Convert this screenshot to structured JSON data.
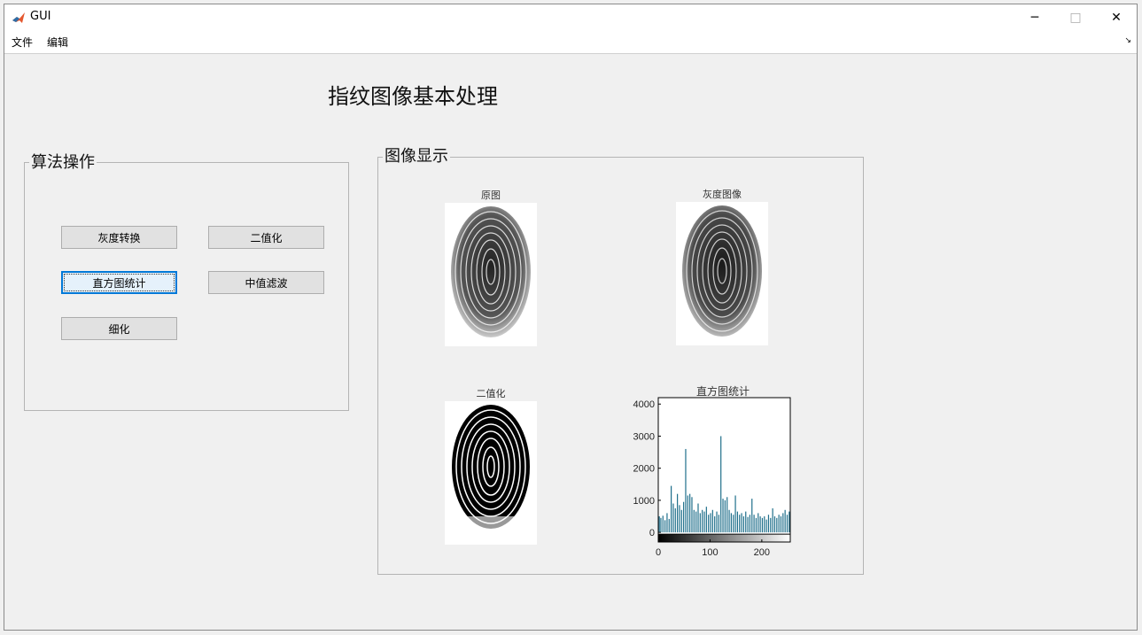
{
  "window": {
    "title": "GUI"
  },
  "window_controls": {
    "minimize": "─",
    "maximize": "□",
    "close": "✕"
  },
  "menu": {
    "items": [
      "文件",
      "编辑"
    ]
  },
  "heading": "指纹图像基本处理",
  "algo_panel": {
    "title": "算法操作",
    "buttons": {
      "gray": "灰度转换",
      "binarize": "二值化",
      "histogram": "直方图统计",
      "median": "中值滤波",
      "thin": "细化"
    }
  },
  "display_panel": {
    "title": "图像显示",
    "images": {
      "original": "原图",
      "gray": "灰度图像",
      "binary": "二值化",
      "histogram": "直方图统计"
    }
  },
  "chart_data": {
    "type": "bar",
    "title": "直方图统计",
    "xlabel": "",
    "ylabel": "",
    "xlim": [
      0,
      255
    ],
    "ylim": [
      -300,
      4200
    ],
    "xticks": [
      0,
      100,
      200
    ],
    "yticks": [
      0,
      1000,
      2000,
      3000,
      4000
    ],
    "colorbar": "grayscale",
    "bars": [
      {
        "x": 2,
        "y": 500
      },
      {
        "x": 5,
        "y": 450
      },
      {
        "x": 9,
        "y": 520
      },
      {
        "x": 13,
        "y": 380
      },
      {
        "x": 17,
        "y": 600
      },
      {
        "x": 21,
        "y": 420
      },
      {
        "x": 25,
        "y": 1450
      },
      {
        "x": 29,
        "y": 900
      },
      {
        "x": 33,
        "y": 750
      },
      {
        "x": 37,
        "y": 1200
      },
      {
        "x": 41,
        "y": 850
      },
      {
        "x": 45,
        "y": 700
      },
      {
        "x": 49,
        "y": 950
      },
      {
        "x": 53,
        "y": 2600
      },
      {
        "x": 57,
        "y": 1150
      },
      {
        "x": 61,
        "y": 1200
      },
      {
        "x": 65,
        "y": 1100
      },
      {
        "x": 69,
        "y": 700
      },
      {
        "x": 73,
        "y": 650
      },
      {
        "x": 77,
        "y": 900
      },
      {
        "x": 81,
        "y": 600
      },
      {
        "x": 85,
        "y": 700
      },
      {
        "x": 89,
        "y": 650
      },
      {
        "x": 93,
        "y": 800
      },
      {
        "x": 97,
        "y": 550
      },
      {
        "x": 101,
        "y": 600
      },
      {
        "x": 105,
        "y": 700
      },
      {
        "x": 109,
        "y": 500
      },
      {
        "x": 113,
        "y": 650
      },
      {
        "x": 117,
        "y": 550
      },
      {
        "x": 121,
        "y": 3000
      },
      {
        "x": 125,
        "y": 1050
      },
      {
        "x": 129,
        "y": 1000
      },
      {
        "x": 133,
        "y": 1100
      },
      {
        "x": 137,
        "y": 700
      },
      {
        "x": 141,
        "y": 600
      },
      {
        "x": 145,
        "y": 550
      },
      {
        "x": 149,
        "y": 1150
      },
      {
        "x": 153,
        "y": 650
      },
      {
        "x": 157,
        "y": 550
      },
      {
        "x": 161,
        "y": 600
      },
      {
        "x": 165,
        "y": 500
      },
      {
        "x": 169,
        "y": 650
      },
      {
        "x": 173,
        "y": 480
      },
      {
        "x": 177,
        "y": 550
      },
      {
        "x": 181,
        "y": 1050
      },
      {
        "x": 185,
        "y": 550
      },
      {
        "x": 189,
        "y": 450
      },
      {
        "x": 193,
        "y": 600
      },
      {
        "x": 197,
        "y": 500
      },
      {
        "x": 201,
        "y": 450
      },
      {
        "x": 205,
        "y": 500
      },
      {
        "x": 209,
        "y": 400
      },
      {
        "x": 213,
        "y": 550
      },
      {
        "x": 217,
        "y": 450
      },
      {
        "x": 221,
        "y": 750
      },
      {
        "x": 225,
        "y": 500
      },
      {
        "x": 229,
        "y": 450
      },
      {
        "x": 233,
        "y": 550
      },
      {
        "x": 237,
        "y": 500
      },
      {
        "x": 241,
        "y": 600
      },
      {
        "x": 245,
        "y": 700
      },
      {
        "x": 249,
        "y": 550
      },
      {
        "x": 253,
        "y": 650
      }
    ],
    "bar_color": "#1f6f8b"
  }
}
